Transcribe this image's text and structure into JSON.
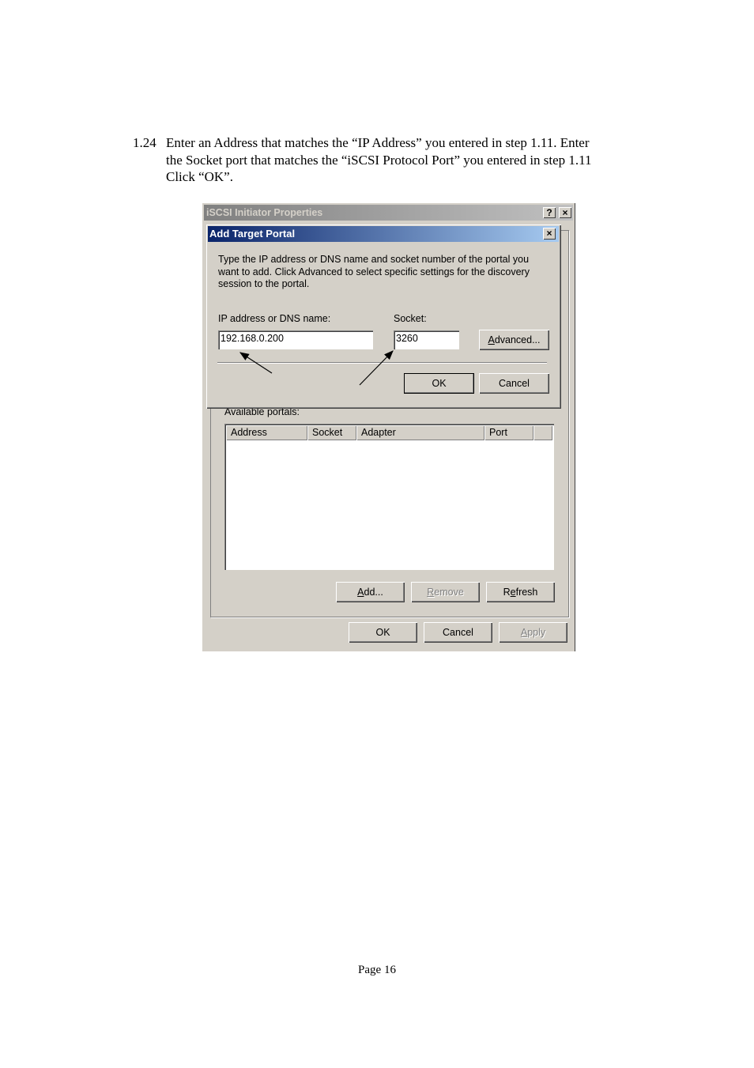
{
  "instruction": {
    "number": "1.24",
    "lines": [
      "Enter an Address that matches the “IP Address” you entered in step 1.11.  Enter",
      "the Socket port that matches the “iSCSI Protocol Port” you entered in step 1.11",
      "Click “OK”."
    ]
  },
  "outer_window": {
    "title": "iSCSI Initiator Properties",
    "help_btn": "?",
    "close_btn": "×",
    "available_portals_label": "Available portals:",
    "columns": [
      "Address",
      "Socket",
      "Adapter",
      "Port"
    ],
    "buttons": {
      "add": {
        "mnemonic": "A",
        "rest": "dd..."
      },
      "remove": {
        "mnemonic": "R",
        "rest": "emove"
      },
      "refresh_pre": "R",
      "refresh_mn": "e",
      "refresh_post": "fresh"
    },
    "footer": {
      "ok": "OK",
      "cancel": "Cancel",
      "apply": {
        "mnemonic": "A",
        "rest": "pply"
      }
    }
  },
  "dialog": {
    "title": "Add Target Portal",
    "close_btn": "×",
    "description": [
      "Type the IP address or DNS name and socket number of the portal you",
      "want to add. Click Advanced to select specific settings for the discovery",
      "session to the portal."
    ],
    "ip_label": "IP address or DNS name:",
    "ip_value": "192.168.0.200",
    "socket_label": "Socket:",
    "socket_value": "3260",
    "advanced": {
      "mnemonic": "A",
      "rest": "dvanced..."
    },
    "ok": "OK",
    "cancel": "Cancel"
  },
  "page_number": "Page 16"
}
